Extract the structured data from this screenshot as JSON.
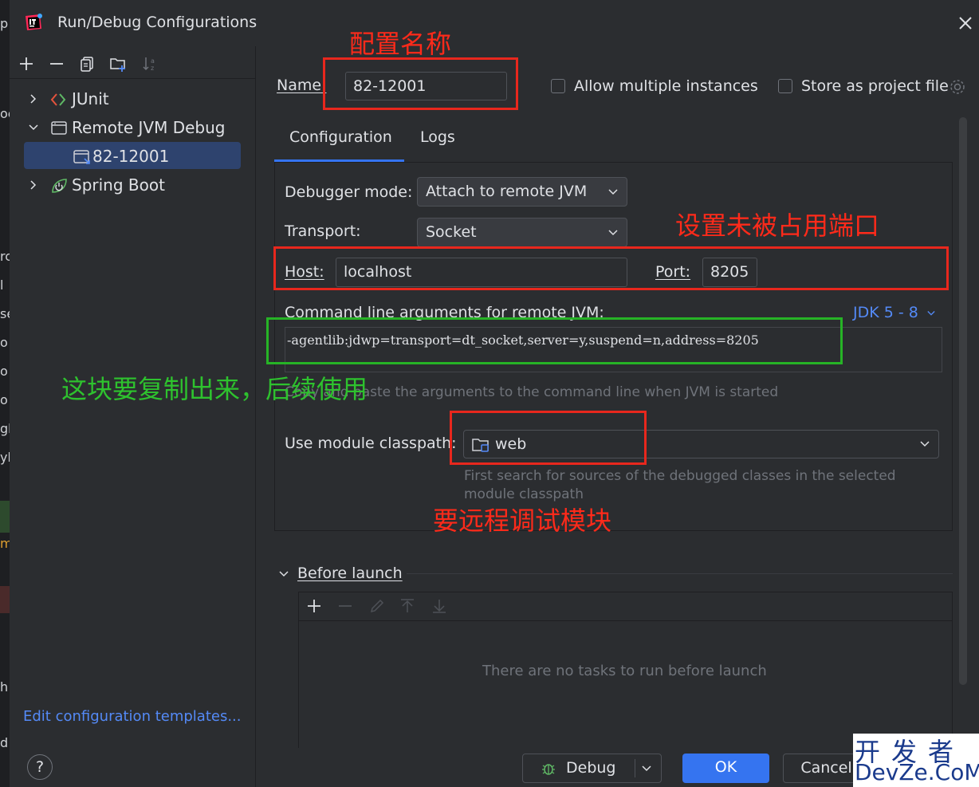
{
  "window": {
    "title": "Run/Debug Configurations"
  },
  "background_window": {
    "edge_chars": [
      "p",
      "oc",
      "rc",
      "l",
      "se",
      "o",
      "o",
      "o",
      "gb",
      "yb",
      "m",
      "h",
      "d"
    ]
  },
  "tree": {
    "items": [
      {
        "label": "JUnit",
        "icon": "junit-icon",
        "expanded": false
      },
      {
        "label": "Remote JVM Debug",
        "icon": "remote-jvm-debug-icon",
        "expanded": true
      },
      {
        "label": "82-12001",
        "icon": "remote-config-icon",
        "selected": true
      },
      {
        "label": "Spring Boot",
        "icon": "spring-boot-icon",
        "expanded": false
      }
    ],
    "edit_templates": "Edit configuration templates..."
  },
  "form": {
    "name_label": "Name:",
    "name_value": "82-12001",
    "allow_multiple": "Allow multiple instances",
    "store_project": "Store as project file",
    "tabs": [
      "Configuration",
      "Logs"
    ],
    "debugger_mode_label": "Debugger mode:",
    "debugger_mode_value": "Attach to remote JVM",
    "transport_label": "Transport:",
    "transport_value": "Socket",
    "host_label": "Host:",
    "host_value": "localhost",
    "port_label": "Port:",
    "port_value": "8205",
    "cmd_label": "Command line arguments for remote JVM:",
    "jdk_link": "JDK 5 - 8",
    "cmd_value": "-agentlib:jdwp=transport=dt_socket,server=y,suspend=n,address=8205",
    "cmd_hint": "Copy and paste the arguments to the command line when JVM is started",
    "module_label": "Use module classpath:",
    "module_value": "web",
    "module_hint_1": "First search for sources of the debugged classes in the selected",
    "module_hint_2": "module classpath",
    "before_launch": "Before launch",
    "no_tasks": "There are no tasks to run before launch"
  },
  "buttons": {
    "help": "?",
    "debug": "Debug",
    "ok": "OK",
    "cancel": "Cancel"
  },
  "annotations": {
    "config_name": "配置名称",
    "unused_port": "设置未被占用端口",
    "copy_note": "这块要复制出来，后续使用",
    "module_note": "要远程调试模块"
  },
  "watermark": {
    "top": "开发者",
    "bottom": "DevZe.CoM"
  },
  "colors": {
    "accent": "#3574f0",
    "link": "#548af7",
    "annotation_red": "#e8271d",
    "annotation_green": "#26b326"
  }
}
